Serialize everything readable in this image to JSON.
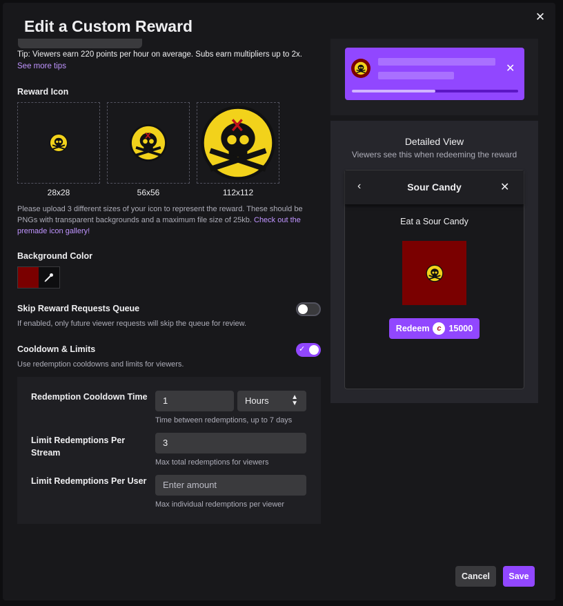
{
  "modal": {
    "title": "Edit a Custom Reward",
    "tip": "Tip: Viewers earn 220 points per hour on average. Subs earn multipliers up to 2x.",
    "tip_link": "See more tips"
  },
  "reward_icon": {
    "label": "Reward Icon",
    "sizes": [
      "28x28",
      "56x56",
      "112x112"
    ],
    "upload_help": "Please upload 3 different sizes of your icon to represent the reward. These should be PNGs with transparent backgrounds and a maximum file size of 25kb.",
    "gallery_link": "Check out the premade icon gallery!"
  },
  "background_color": {
    "label": "Background Color",
    "value": "#7a0000"
  },
  "skip_queue": {
    "label": "Skip Reward Requests Queue",
    "help": "If enabled, only future viewer requests will skip the queue for review.",
    "enabled": false
  },
  "cooldown": {
    "label": "Cooldown & Limits",
    "help": "Use redemption cooldowns and limits for viewers.",
    "enabled": true,
    "cooldown_time_label": "Redemption Cooldown Time",
    "cooldown_time_value": "1",
    "cooldown_unit": "Hours",
    "cooldown_help": "Time between redemptions, up to 7 days",
    "per_stream_label": "Limit Redemptions Per Stream",
    "per_stream_value": "3",
    "per_stream_help": "Max total redemptions for viewers",
    "per_user_label": "Limit Redemptions Per User",
    "per_user_placeholder": "Enter amount",
    "per_user_help": "Max individual redemptions per viewer"
  },
  "detailed_view": {
    "title": "Detailed View",
    "subtitle": "Viewers see this when redeeming the reward",
    "card_title": "Sour Candy",
    "reward_name": "Eat a Sour Candy",
    "redeem_label": "Redeem",
    "cost": "15000"
  },
  "footer": {
    "cancel": "Cancel",
    "save": "Save"
  },
  "colors": {
    "accent": "#9147ff",
    "background": "#18181b",
    "reward_bg": "#7a0000"
  }
}
